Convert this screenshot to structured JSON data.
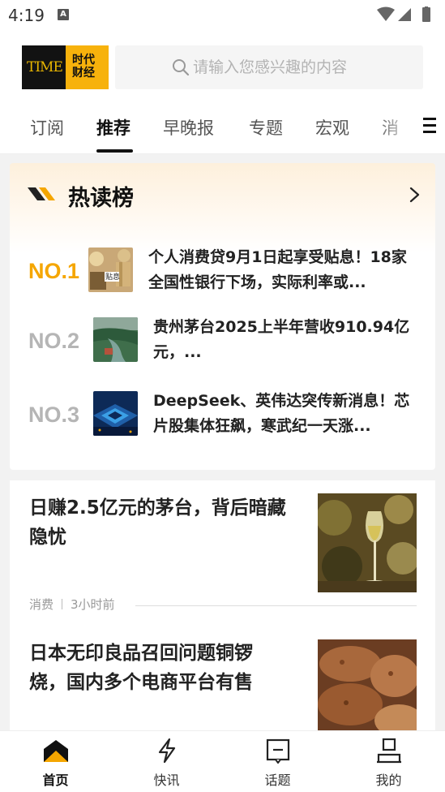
{
  "status_bar": {
    "time": "4:19",
    "notification": "A"
  },
  "header": {
    "logo_left": "TIME",
    "logo_right_line1": "时代",
    "logo_right_line2": "财经",
    "search_placeholder": "请输入您感兴趣的内容"
  },
  "tabs": [
    "订阅",
    "推荐",
    "早晚报",
    "专题",
    "宏观",
    "消"
  ],
  "active_tab": "推荐",
  "hot_list": {
    "title": "热读榜",
    "items": [
      {
        "rank": "NO.1",
        "text": "个人消费贷9月1日起享受贴息！18家全国性银行下场，实际利率或...",
        "thumb_caption": "贴息"
      },
      {
        "rank": "NO.2",
        "text": "贵州茅台2025上半年营收910.94亿元，..."
      },
      {
        "rank": "NO.3",
        "text": "DeepSeek、英伟达突传新消息！芯片股集体狂飙，寒武纪一天涨..."
      }
    ]
  },
  "feed": [
    {
      "title": "日赚2.5亿元的茅台，背后暗藏隐忧",
      "category": "消费",
      "time": "3小时前"
    },
    {
      "title": "日本无印良品召回问题铜锣烧，国内多个电商平台有售"
    }
  ],
  "bottom_nav": [
    {
      "label": "首页",
      "icon": "home-icon",
      "active": true
    },
    {
      "label": "快讯",
      "icon": "lightning-icon",
      "active": false
    },
    {
      "label": "话题",
      "icon": "topic-icon",
      "active": false
    },
    {
      "label": "我的",
      "icon": "profile-icon",
      "active": false
    }
  ],
  "colors": {
    "accent": "#f5a600",
    "brand_yellow": "#f7b20c",
    "text_dark": "#111111"
  }
}
